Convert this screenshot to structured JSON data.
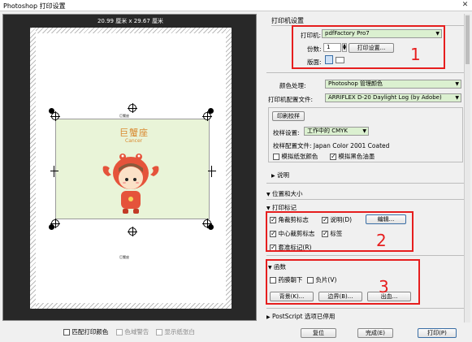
{
  "window": {
    "title": "Photoshop 打印设置",
    "close_label": "✕"
  },
  "preview": {
    "size_label": "20.99 厘米 x 29.67 厘米",
    "crop_title_top": "巨蟹座",
    "image_title": "巨蟹座",
    "image_subtitle": "Cancer",
    "crop_bottom_label": "巨蟹座"
  },
  "bottom_options": [
    {
      "label": "匹配打印颜色",
      "checked": false,
      "disabled": false
    },
    {
      "label": "色域警告",
      "checked": false,
      "disabled": true
    },
    {
      "label": "显示纸张白",
      "checked": false,
      "disabled": true
    }
  ],
  "printer_setup": {
    "section_title": "打印机设置",
    "printer_label": "打印机:",
    "printer_value": "pdfFactory Pro7",
    "copies_label": "份数:",
    "copies_value": "1",
    "print_settings_button": "打印设置...",
    "layout_label": "版面:"
  },
  "color": {
    "handling_label": "颜色处理:",
    "handling_value": "Photoshop 管理颜色",
    "profile_label": "打印机配置文件:",
    "profile_value": "ARRIFLEX D-20 Daylight Log (by Adobe)",
    "proof_group": "印刷校样",
    "proof_setup_label": "校样设置:",
    "proof_setup_value": "工作中的 CMYK",
    "proof_profile_text": "校样配置文件: Japan Color 2001 Coated",
    "sim_paper": "模拟纸张颜色",
    "sim_black": "模拟黑色油墨",
    "sim_black_checked": true
  },
  "sections": {
    "description": "说明",
    "position_size": "位置和大小",
    "print_marks": "打印标记",
    "functions": "函数",
    "postscript": "PostScript 选项已停用"
  },
  "print_marks": {
    "corner_crop": "角裁剪标志",
    "center_crop": "中心裁剪标志",
    "registration": "套准标记(R)",
    "description": "说明(D)",
    "labels": "标签",
    "edit_button": "编辑..."
  },
  "functions": {
    "emulsion_down": "药膜朝下",
    "negative": "负片(V)",
    "background_button": "背景(K)...",
    "border_button": "边界(B)...",
    "bleed_button": "出血..."
  },
  "footer": {
    "reset": "复位",
    "done": "完成(E)",
    "print": "打印(P)"
  },
  "annotations": [
    "1",
    "2",
    "3"
  ],
  "colors": {
    "highlight_green": "#dbf0d0",
    "annotation_red": "#e61e1e",
    "preview_bg": "#282828"
  }
}
